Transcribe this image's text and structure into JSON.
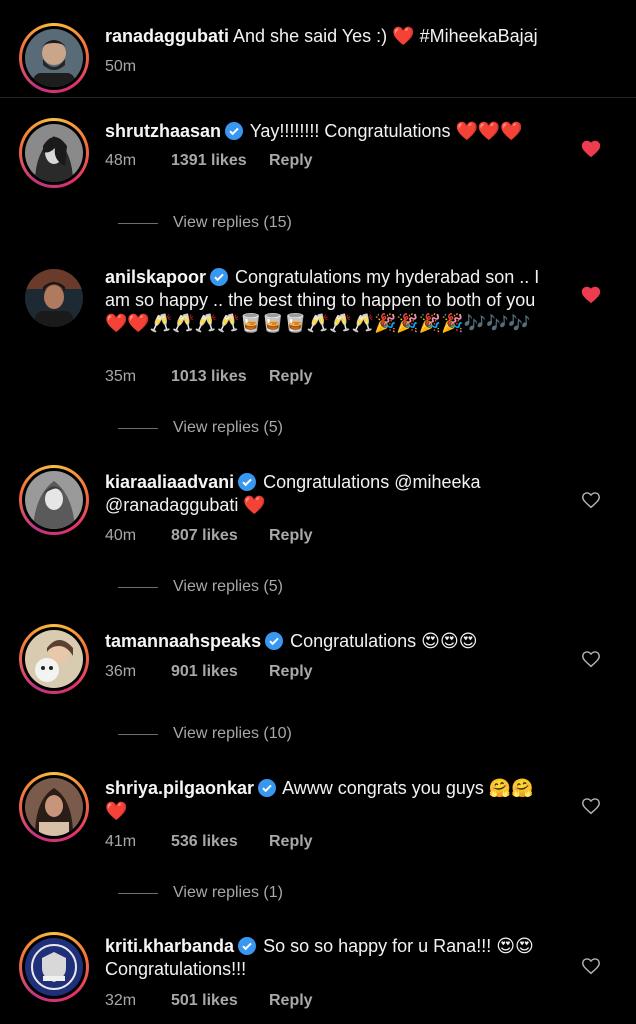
{
  "caption": {
    "username": "ranadaggubati",
    "text": "And she said Yes :) ❤️",
    "hashtag": "#MiheekaBajaj",
    "time": "50m"
  },
  "comments": [
    {
      "username": "shrutzhaasan",
      "text": "Yay!!!!!!!! Congratulations ❤️❤️❤️",
      "time": "48m",
      "likes": "1391 likes",
      "reply": "Reply",
      "view_replies": "View replies (15)",
      "liked": true
    },
    {
      "username": "anilskapoor",
      "text": "Congratulations my hyderabad son .. I am so happy .. the best thing to happen to both of you ❤️❤️🥂🥂🥂🥂🥃🥃🥃🥂🥂🥂🎉🎉🎉🎉🎶🎶🎶",
      "time": "35m",
      "likes": "1013 likes",
      "reply": "Reply",
      "view_replies": "View replies (5)",
      "liked": true
    },
    {
      "username": "kiaraaliaadvani",
      "text": "Congratulations @miheeka @ranadaggubati ❤️",
      "time": "40m",
      "likes": "807 likes",
      "reply": "Reply",
      "view_replies": "View replies (5)",
      "liked": false
    },
    {
      "username": "tamannaahspeaks",
      "text": "Congratulations 😍😍😍",
      "time": "36m",
      "likes": "901 likes",
      "reply": "Reply",
      "view_replies": "View replies (10)",
      "liked": false
    },
    {
      "username": "shriya.pilgaonkar",
      "text": "Awww congrats you guys 🤗🤗❤️",
      "time": "41m",
      "likes": "536 likes",
      "reply": "Reply",
      "view_replies": "View replies (1)",
      "liked": false
    },
    {
      "username": "kriti.kharbanda",
      "text": "So so so happy for u Rana!!! 😍😍 Congratulations!!!",
      "time": "32m",
      "likes": "501 likes",
      "reply": "Reply",
      "liked": false
    }
  ],
  "colors": {
    "background": "#000000",
    "text": "#f2f2f2",
    "muted": "#a8a8a8",
    "heart_liked": "#ed3b50",
    "verified": "#3897f0"
  },
  "icons": {
    "verified": "verified-badge-icon",
    "like_filled": "heart-filled-icon",
    "like_outline": "heart-outline-icon"
  }
}
